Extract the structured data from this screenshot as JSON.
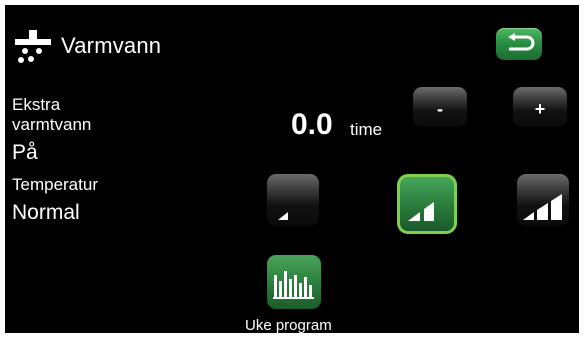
{
  "header": {
    "title": "Varmvann",
    "icon": "shower-icon",
    "back_icon": "back-arrow-icon"
  },
  "extra_hot_water": {
    "label": "Ekstra\nvarmtvann",
    "label_line1": "Ekstra",
    "label_line2": "varmtvann",
    "status": "På",
    "value": "0.0",
    "unit": "time"
  },
  "controls": {
    "minus_label": "-",
    "plus_label": "+"
  },
  "temperature": {
    "label": "Temperatur",
    "value": "Normal",
    "levels": 3,
    "selected_level": 2
  },
  "program": {
    "label": "Uke program",
    "icon": "bar-chart-icon"
  },
  "colors": {
    "accent_green": "#2f8f45",
    "selected_border": "#7fd04e",
    "background": "#000000",
    "text": "#ffffff"
  }
}
